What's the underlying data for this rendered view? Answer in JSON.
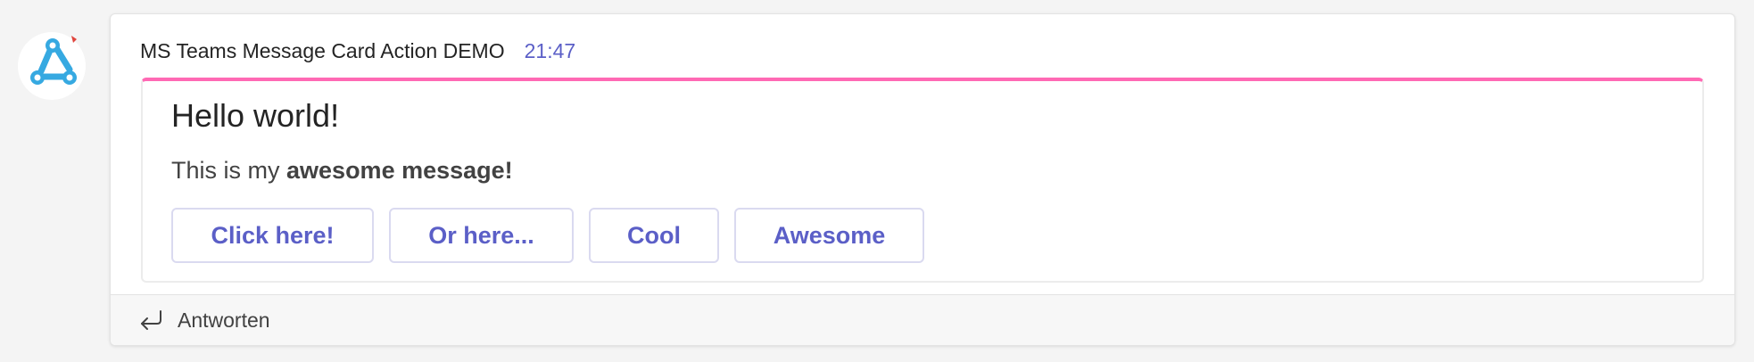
{
  "message": {
    "sender": "MS Teams Message Card Action DEMO",
    "time": "21:47"
  },
  "card": {
    "accent_color": "#ff69b4",
    "title": "Hello world!",
    "text_prefix": "This is my ",
    "text_bold": "awesome message!",
    "actions": [
      {
        "label": "Click here!"
      },
      {
        "label": "Or here..."
      },
      {
        "label": "Cool"
      },
      {
        "label": "Awesome"
      }
    ]
  },
  "footer": {
    "reply_icon": "reply-arrow-icon",
    "reply_label": "Antworten"
  },
  "avatar": {
    "icon": "webhook-icon",
    "color": "#36a9e1"
  }
}
